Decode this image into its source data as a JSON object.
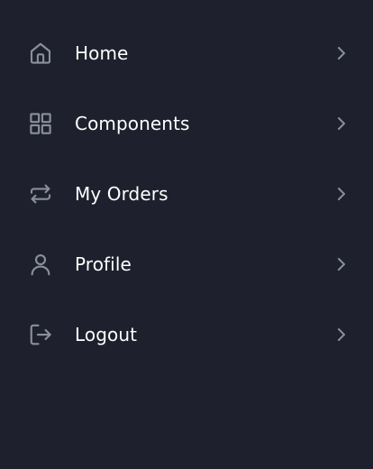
{
  "menu": {
    "items": [
      {
        "label": "Home",
        "icon": "home-icon"
      },
      {
        "label": "Components",
        "icon": "grid-icon"
      },
      {
        "label": "My Orders",
        "icon": "repeat-icon"
      },
      {
        "label": "Profile",
        "icon": "user-icon"
      },
      {
        "label": "Logout",
        "icon": "logout-icon"
      }
    ]
  },
  "colors": {
    "background": "#1e212d",
    "icon": "#8b8f9c",
    "text": "#ffffff"
  }
}
